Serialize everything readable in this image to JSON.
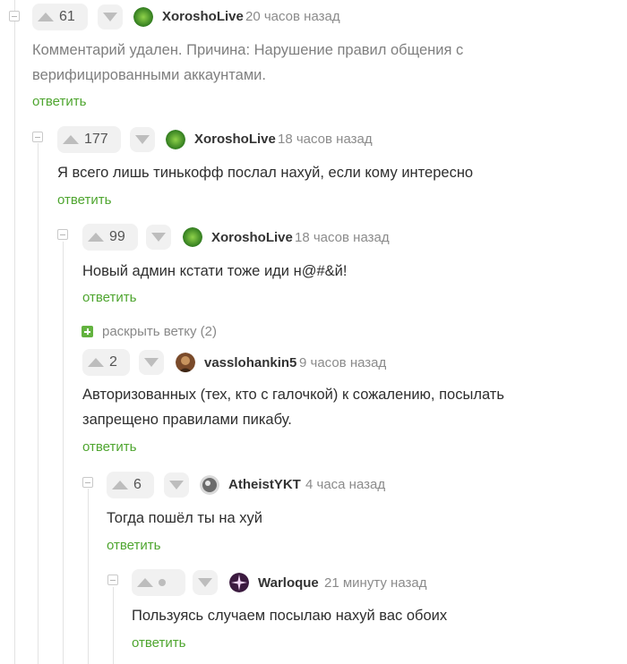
{
  "comments": [
    {
      "score": "61",
      "author": "XoroshoLive",
      "time": "20 часов назад",
      "text": "Комментарий удален. Причина: Нарушение правил общения с верифицированными аккаунтами.",
      "reply": "ответить"
    },
    {
      "score": "177",
      "author": "XoroshoLive",
      "time": "18 часов назад",
      "text": "Я всего лишь тинькофф послал нахуй, если кому интересно",
      "reply": "ответить"
    },
    {
      "score": "99",
      "author": "XoroshoLive",
      "time": "18 часов назад",
      "text": "Новый админ кстати тоже иди н@#&й!",
      "reply": "ответить"
    },
    {
      "score": "2",
      "author": "vasslohankin5",
      "time": "9 часов назад",
      "text": "Авторизованных (тех, кто с галочкой) к сожалению, посылать запрещено правилами пикабу.",
      "reply": "ответить"
    },
    {
      "score": "6",
      "author": "AtheistYKT",
      "time": "4 часа назад",
      "text": "Тогда пошёл ты на хуй",
      "reply": "ответить"
    },
    {
      "score": "",
      "author": "Warloque",
      "time": "21 минуту назад",
      "text": "Пользуясь случаем посылаю нахуй вас обоих",
      "reply": "ответить"
    }
  ],
  "expand_branch": {
    "label": "раскрыть ветку (2)"
  },
  "colors": {
    "reply": "#4ea52f",
    "expand": "#63b33f",
    "vote_bg": "#f1f1f1",
    "thread_line": "#e3e3e3"
  }
}
